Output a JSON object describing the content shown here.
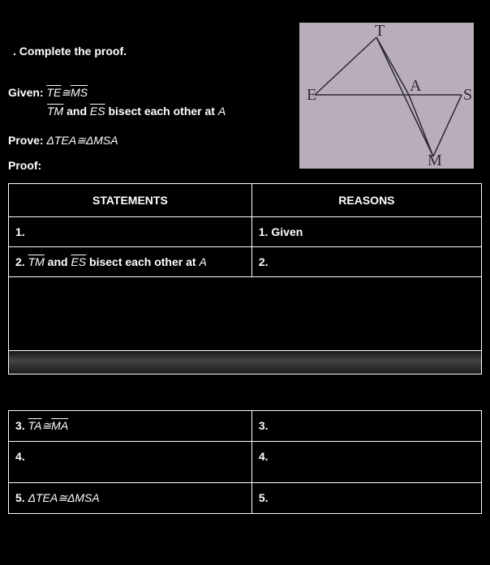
{
  "instruction": "Complete the proof.",
  "given": {
    "label": "Given:",
    "line1_a": "TE",
    "line1_sym": "≅",
    "line1_b": "MS",
    "line2_a": "TM",
    "line2_mid": " and ",
    "line2_b": "ES",
    "line2_rest": " bisect each other at ",
    "line2_pt": "A"
  },
  "prove": {
    "label": "Prove:",
    "tri1": "ΔTEA",
    "sym": "≅",
    "tri2": "ΔMSA"
  },
  "proof_label": "Proof:",
  "headers": {
    "stmt": "STATEMENTS",
    "reason": "REASONS"
  },
  "rows": [
    {
      "stmt_num": "1.",
      "stmt_body": "",
      "reason_num": "1.",
      "reason_body": " Given"
    },
    {
      "stmt_num": "2. ",
      "stmt_ol1": "TM",
      "stmt_mid": " and ",
      "stmt_ol2": "ES",
      "stmt_rest": " bisect each other at ",
      "stmt_pt": "A",
      "reason_num": "2.",
      "reason_body": ""
    },
    {
      "stmt_num": "3. ",
      "stmt_ol1": "TA",
      "stmt_sym": "≅",
      "stmt_ol2": "MA",
      "reason_num": "3.",
      "reason_body": ""
    },
    {
      "stmt_num": "4.",
      "stmt_body": "",
      "reason_num": "4.",
      "reason_body": ""
    },
    {
      "stmt_num": "5. ",
      "stmt_tri1": "ΔTEA",
      "stmt_sym": "≅",
      "stmt_tri2": "ΔMSA",
      "reason_num": "5.",
      "reason_body": ""
    }
  ],
  "diagram": {
    "T": "T",
    "E": "E",
    "A": "A",
    "S": "S",
    "M": "M"
  }
}
